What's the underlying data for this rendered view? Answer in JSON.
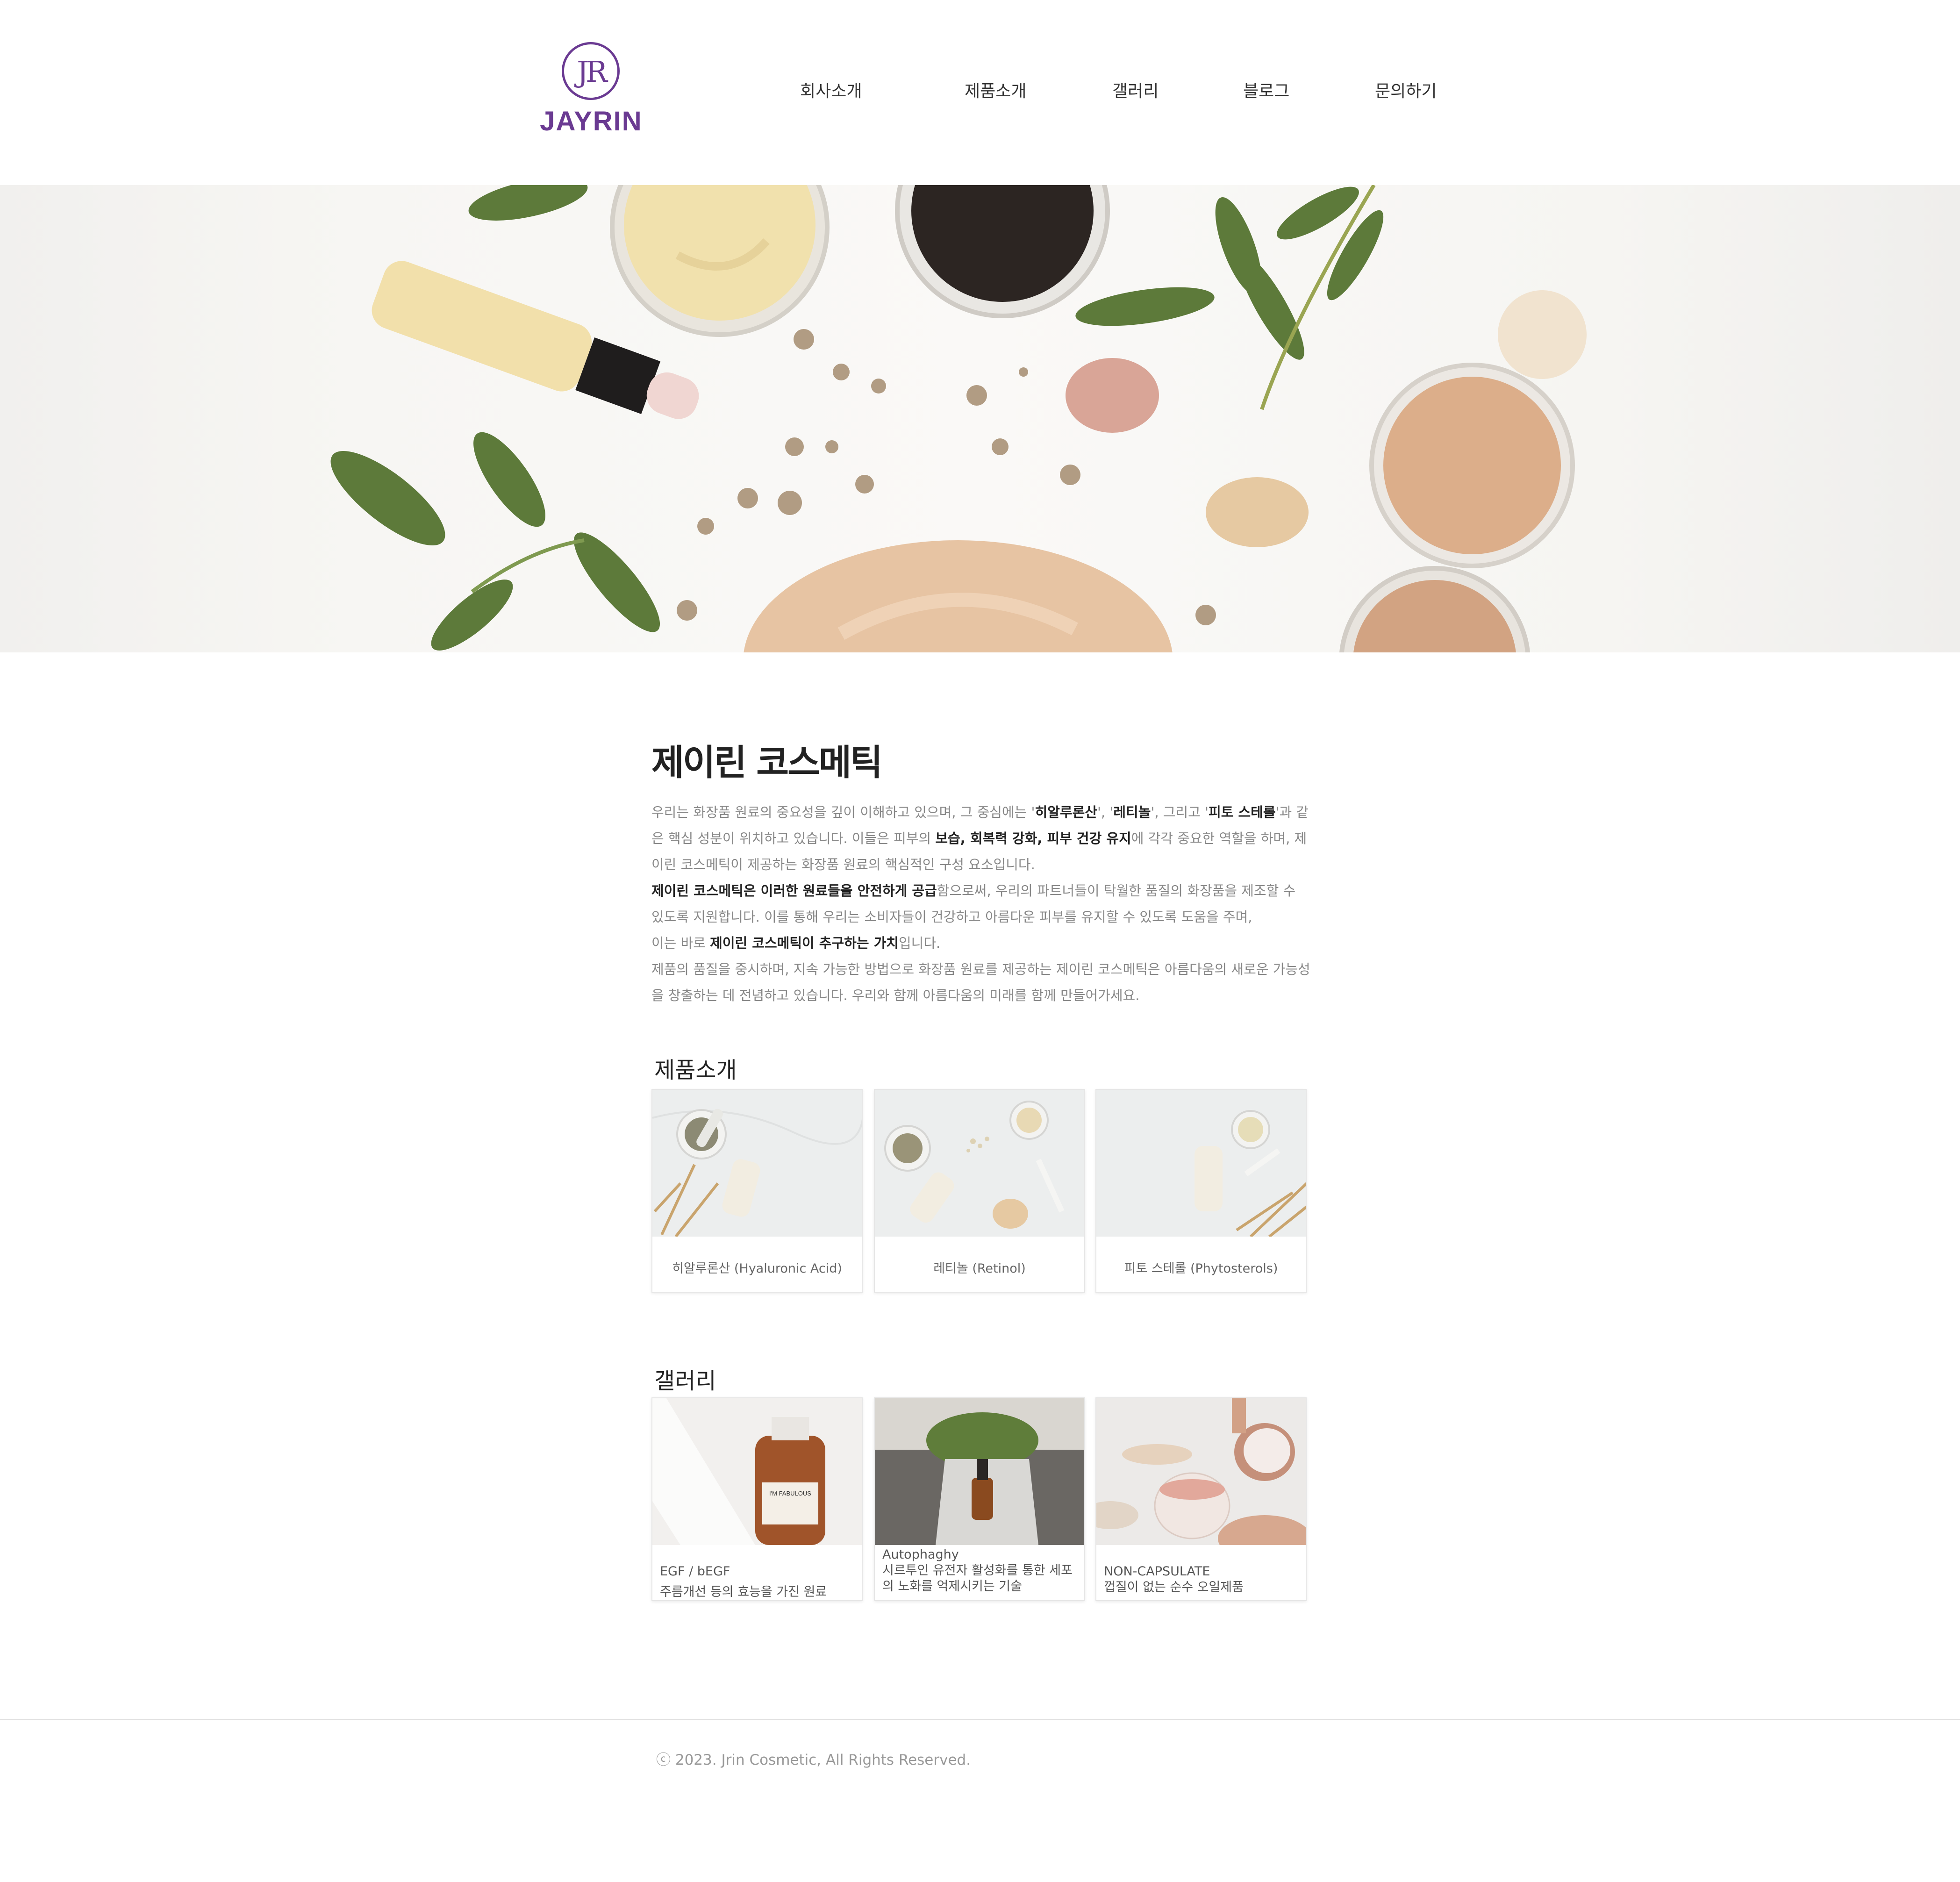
{
  "brand": {
    "name": "JAYRIN",
    "mark": "JR",
    "color": "#6a3a92"
  },
  "nav": [
    "회사소개",
    "제품소개",
    "갤러리",
    "블로그",
    "문의하기"
  ],
  "intro": {
    "title": "제이린 코스메틱",
    "p1": [
      {
        "t": "우리는 화장품 원료의 중요성을 깊이 이해하고 있으며, 그 중심에는 '",
        "b": false
      },
      {
        "t": "히알루론산",
        "b": true
      },
      {
        "t": "', '",
        "b": false
      },
      {
        "t": "레티놀",
        "b": true
      },
      {
        "t": "', 그리고 '",
        "b": false
      },
      {
        "t": "피토 스테롤",
        "b": true
      },
      {
        "t": "'과 같은 핵심 성분이 위치하고 있습니다. 이들은 피부의 ",
        "b": false
      },
      {
        "t": "보습, 회복력 강화, 피부 건강 유지",
        "b": true
      },
      {
        "t": "에 각각 중요한 역할을 하며, 제이린 코스메틱이 제공하는 화장품 원료의 핵심적인 구성 요소입니다.",
        "b": false
      }
    ],
    "p2": [
      {
        "t": "제이린 코스메틱은 이러한 원료들을 안전하게 공급",
        "b": true
      },
      {
        "t": "함으로써, 우리의 파트너들이 탁월한 품질의 화장품을 제조할 수 있도록 지원합니다. 이를 통해 우리는 소비자들이 건강하고 아름다운 피부를 유지할 수 있도록 도움을 주며,",
        "b": false
      }
    ],
    "p3": [
      {
        "t": "이는 바로 ",
        "b": false
      },
      {
        "t": "제이린 코스메틱이 추구하는 가치",
        "b": true
      },
      {
        "t": "입니다.",
        "b": false
      }
    ],
    "p4": "제품의 품질을 중시하며, 지속 가능한 방법으로 화장품 원료를 제공하는 제이린 코스메틱은 아름다움의 새로운 가능성을 창출하는 데 전념하고 있습니다. 우리와 함께 아름다움의 미래를 함께 만들어가세요."
  },
  "products": {
    "title": "제품소개",
    "items": [
      {
        "label": "히알루론산 (Hyaluronic Acid)"
      },
      {
        "label": "레티놀 (Retinol)"
      },
      {
        "label": "피토 스테롤 (Phytosterols)"
      }
    ]
  },
  "gallery": {
    "title": "갤러리",
    "items": [
      {
        "title": "EGF / bEGF",
        "desc": "주름개선 등의 효능을 가진 원료",
        "bottle_label": "I'M FABULOUS"
      },
      {
        "title": "Autophaghy",
        "desc": "시르투인 유전자 활성화를 통한 세포의 노화를 억제시키는 기술"
      },
      {
        "title": "NON-CAPSULATE",
        "desc": "껍질이 없는 순수 오일제품"
      }
    ]
  },
  "footer": {
    "copyright": "ⓒ 2023. Jrin Cosmetic, All Rights Reserved."
  }
}
